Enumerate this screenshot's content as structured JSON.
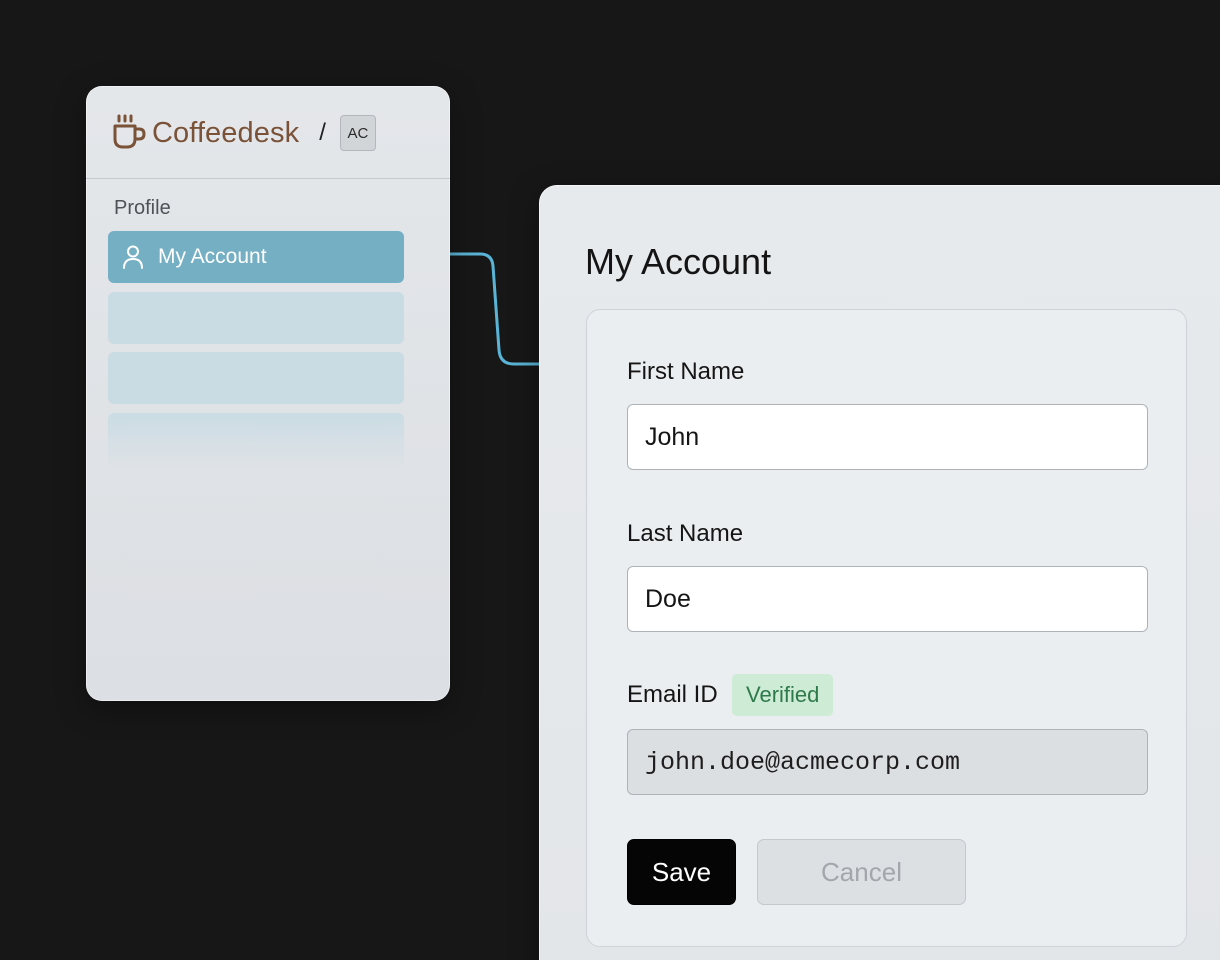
{
  "brand": {
    "name": "Coffeedesk",
    "separator": "/",
    "org_initials": "AC",
    "color": "#7a5238"
  },
  "sidebar": {
    "section_label": "Profile",
    "items": [
      {
        "label": "My Account",
        "icon": "user-icon",
        "active": true
      }
    ],
    "accent": "#74afc4"
  },
  "main": {
    "title": "My Account",
    "form": {
      "first_name": {
        "label": "First Name",
        "value": "John"
      },
      "last_name": {
        "label": "Last Name",
        "value": "Doe"
      },
      "email": {
        "label": "Email ID",
        "badge": "Verified",
        "value": "john.doe@acmecorp.com"
      },
      "save_label": "Save",
      "cancel_label": "Cancel"
    }
  },
  "colors": {
    "background": "#171717",
    "connector": "#5ab4d6",
    "verified_bg": "#cdebd5",
    "verified_text": "#2f7a4a"
  }
}
